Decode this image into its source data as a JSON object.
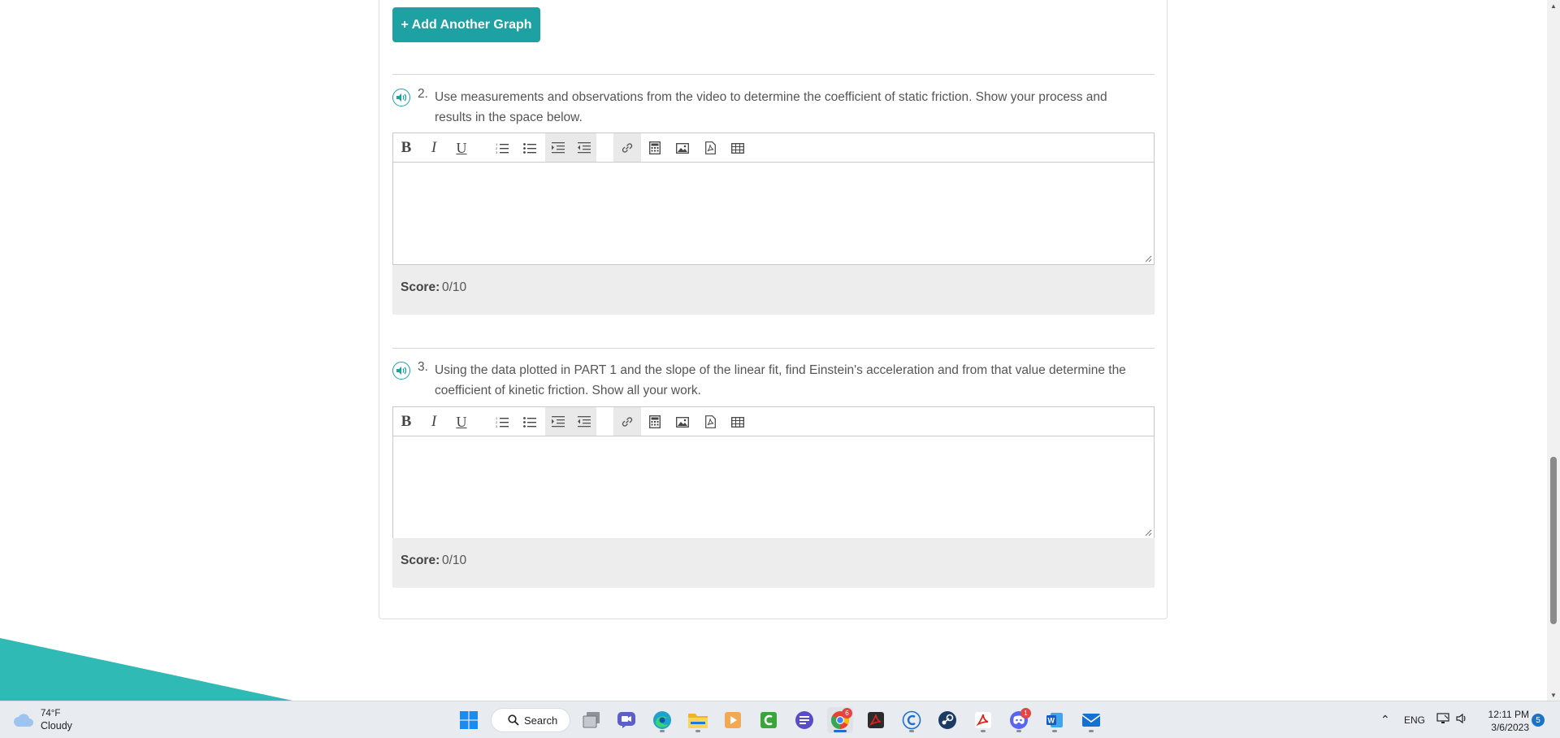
{
  "page": {
    "add_graph_label": "+ Add Another Graph"
  },
  "questions": [
    {
      "number": "2.",
      "text": "Use measurements and observations from the video to determine the coefficient of static friction. Show your process and results in the space below.",
      "score_label": "Score:",
      "score_value": "0/10"
    },
    {
      "number": "3.",
      "text": "Using the data plotted in PART 1 and the slope of the linear fit, find Einstein's acceleration and from that value determine the coefficient of kinetic friction. Show all your work.",
      "score_label": "Score:",
      "score_value": "0/10"
    }
  ],
  "editor_toolbar": {
    "bold": "B",
    "italic": "I",
    "underline": "U"
  },
  "taskbar": {
    "weather_temp": "74°F",
    "weather_condition": "Cloudy",
    "search_label": "Search",
    "language": "ENG",
    "time": "12:11 PM",
    "date": "3/6/2023",
    "chrome_badge": "6",
    "discord_badge": "1",
    "notification_count": "5"
  },
  "colors": {
    "accent": "#1da1a3",
    "score_bg": "#ededed",
    "taskbar_bg": "#e8ecf1"
  }
}
